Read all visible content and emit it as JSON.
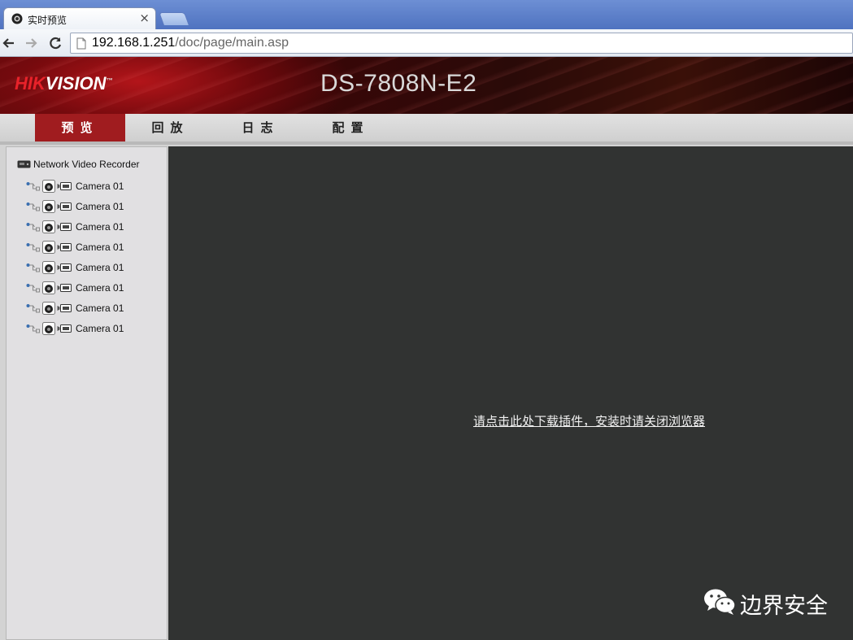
{
  "browser": {
    "tab_title": "实时预览",
    "url_host": "192.168.1.251",
    "url_path": "/doc/page/main.asp",
    "icons": {
      "back": "back-arrow-icon",
      "forward": "forward-arrow-icon",
      "reload": "reload-icon",
      "close_tab": "close-icon",
      "page": "page-icon"
    }
  },
  "header": {
    "logo_hik": "HIK",
    "logo_vision": "VISION",
    "model": "DS-7808N-E2"
  },
  "menu": {
    "items": [
      {
        "label": "预览",
        "active": true
      },
      {
        "label": "回放",
        "active": false
      },
      {
        "label": "日志",
        "active": false
      },
      {
        "label": "配置",
        "active": false
      }
    ]
  },
  "sidebar": {
    "root_label": "Network Video Recorder",
    "cameras": [
      {
        "label": "Camera 01"
      },
      {
        "label": "Camera 01"
      },
      {
        "label": "Camera 01"
      },
      {
        "label": "Camera 01"
      },
      {
        "label": "Camera 01"
      },
      {
        "label": "Camera 01"
      },
      {
        "label": "Camera 01"
      },
      {
        "label": "Camera 01"
      }
    ]
  },
  "video": {
    "plugin_link": "请点击此处下载插件，安装时请关闭浏览器"
  },
  "watermark": {
    "text": "边界安全"
  },
  "colors": {
    "accent_red": "#a01c1f",
    "video_bg": "#313332",
    "sidebar_bg": "#e1e0e2"
  }
}
